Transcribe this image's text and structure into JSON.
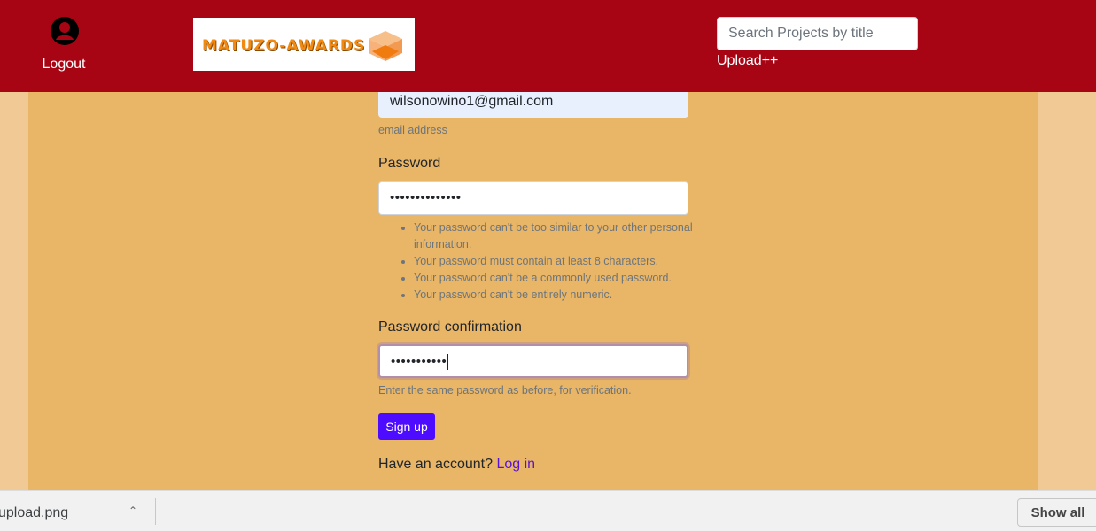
{
  "header": {
    "logout_label": "Logout",
    "logo_text": "MATUZO-AWARDS",
    "search_placeholder": "Search Projects by title",
    "upload_label": "Upload++",
    "bg_color": "#a70414"
  },
  "form": {
    "email_value": "wilsonowino1@gmail.com",
    "email_hint": "email address",
    "password_label": "Password",
    "password_mask": "••••••••••••••",
    "password_rules": [
      "Your password can't be too similar to your other personal information.",
      "Your password must contain at least 8 characters.",
      "Your password can't be a commonly used password.",
      "Your password can't be entirely numeric."
    ],
    "confirm_label": "Password confirmation",
    "confirm_mask": "•••••••••••",
    "confirm_hint": "Enter the same password as before, for verification.",
    "signup_label": "Sign up",
    "have_account_text": "Have an account?",
    "login_label": "Log in",
    "accent_color": "#4d0bff"
  },
  "downloads": {
    "file_name": "upload.png",
    "show_all_label": "Show all"
  }
}
